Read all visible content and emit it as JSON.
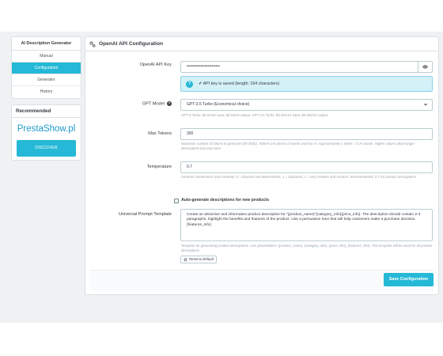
{
  "sidebar": {
    "title": "AI Description Generator",
    "items": [
      {
        "label": "Manual",
        "active": false
      },
      {
        "label": "Configuration",
        "active": true
      },
      {
        "label": "Generator",
        "active": false
      },
      {
        "label": "History",
        "active": false
      }
    ]
  },
  "recommended": {
    "title": "Recommended",
    "logo_text": "PrestaShow.pl",
    "button_label": "DISCOVER"
  },
  "panel": {
    "title": "OpenAI API Configuration",
    "icon": "gear-icon"
  },
  "fields": {
    "api_key": {
      "label": "OpenAI API Key",
      "value": "••••••••••••••••••••••••",
      "alert": "✔ API key is saved (length: 164 characters)"
    },
    "gpt_model": {
      "label": "GPT Model",
      "value": "GPT-3.5 Turbo (Economical choice)",
      "help": "GPT-4 Turbo: $0.01/1K input, $0.03/1K output. GPT-3.5 Turbo: $0.001/1K input, $0.002/1K output."
    },
    "max_tokens": {
      "label": "Max Tokens",
      "value": "300",
      "help": "Maximum number of tokens to generate (50-4000). Tokens are pieces of words used by AI. Approximately 1 token = 0.75 words. Higher values allow longer descriptions but cost more."
    },
    "temperature": {
      "label": "Temperature",
      "value": "0.7",
      "help": "Controls randomness and creativity: 0 = focused and deterministic, 1 = balanced, 2 = very creative and random. Recommended: 0.7 for product descriptions."
    },
    "auto_generate": {
      "label": "Auto-generate descriptions for new products",
      "checked": false
    },
    "prompt": {
      "label": "Universal Prompt Template",
      "value": "Create an attractive and informative product description for \"{product_name}\"{category_info}{price_info}. The description should contain 2-3 paragraphs, highlight the benefits and features of the product. Use a persuasive tone that will help customers make a purchase decision.{features_info}",
      "help": "Template for generating product descriptions. Use placeholders: {product_name}, {category_info}, {price_info}, {features_info}. This template will be used for all product descriptions.",
      "reset_label": "Reset to Default"
    }
  },
  "footer": {
    "save_label": "Save Configuration"
  },
  "colors": {
    "accent": "#25b9d7",
    "alert_bg": "#d3f1f7",
    "page_bg": "#eff1f2"
  }
}
